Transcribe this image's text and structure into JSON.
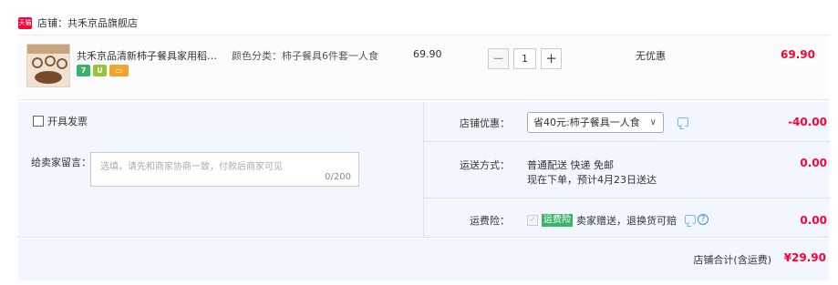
{
  "shop": {
    "name": "店铺：共禾京品旗舰店",
    "icon": "tmall-shop-icon",
    "icon_text": "天猫"
  },
  "item": {
    "title": "共禾京品清新柿子餐具家用稻下...",
    "sku": "颜色分类：柿子餐具6件套一人食",
    "unit_price": "69.90",
    "quantity": "1",
    "qty_minus": "−",
    "qty_plus": "+",
    "discount": "无优惠",
    "total": "69.90",
    "badges": [
      "7",
      "U",
      "▭"
    ]
  },
  "options": {
    "invoice_label": "开具发票",
    "message_label": "给卖家留言：",
    "message_placeholder": "选填，请先和商家协商一致，付款后商家可见",
    "message_count": "0/200"
  },
  "shop_discount": {
    "label": "店铺优惠：",
    "selected": "省40元:柿子餐具一人食",
    "arrow": "∨",
    "amount": "-40.00"
  },
  "shipping": {
    "label": "运送方式：",
    "line1": "普通配送 快递 免邮",
    "line2": "现在下单，预计4月23日送达",
    "amount": "0.00"
  },
  "insurance": {
    "label": "运费险：",
    "check_mark": "✓",
    "tag": "运费险",
    "text": "卖家赠送，退换货可赔",
    "help": "?",
    "amount": "0.00"
  },
  "summary": {
    "label": "店铺合计(含运费)",
    "amount": "¥29.90"
  },
  "colors": {
    "price_red": "#ff0036",
    "panel_blue": "#f2f7ff",
    "tag_green": "#3bb36a"
  }
}
